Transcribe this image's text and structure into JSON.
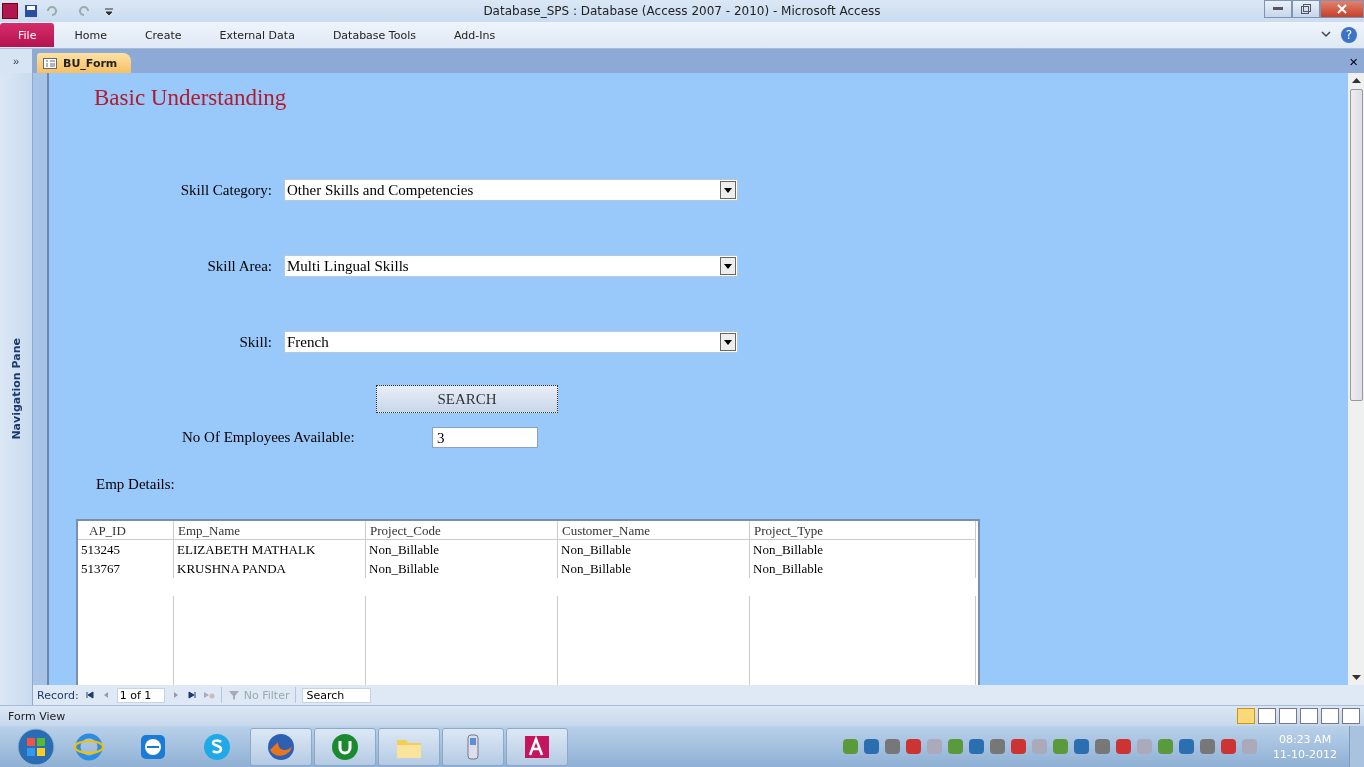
{
  "window": {
    "title": "Database_SPS : Database (Access 2007 - 2010)  -  Microsoft Access"
  },
  "ribbon_tabs": [
    {
      "label": "File",
      "selected": true
    },
    {
      "label": "Home",
      "selected": false
    },
    {
      "label": "Create",
      "selected": false
    },
    {
      "label": "External Data",
      "selected": false
    },
    {
      "label": "Database Tools",
      "selected": false
    },
    {
      "label": "Add-Ins",
      "selected": false
    }
  ],
  "help": "?",
  "navigation_pane": {
    "expand": "»",
    "label": "Navigation Pane"
  },
  "document_tab": {
    "label": "BU_Form",
    "close": "×"
  },
  "form": {
    "title": "Basic Understanding",
    "fields": [
      {
        "label": "Skill Category:",
        "value": "Other Skills and Competencies"
      },
      {
        "label": "Skill Area:",
        "value": "Multi Lingual Skills"
      },
      {
        "label": "Skill:",
        "value": "French"
      }
    ],
    "search_button": "SEARCH",
    "count": {
      "label": "No Of Employees Available:",
      "value": "3"
    },
    "details_label": "Emp Details:",
    "table": {
      "columns": [
        "AP_ID",
        "Emp_Name",
        "Project_Code",
        "Customer_Name",
        "Project_Type"
      ],
      "rows": [
        [
          "513245",
          "ELIZABETH MATHALK",
          "Non_Billable",
          "Non_Billable",
          "Non_Billable"
        ],
        [
          "513767",
          "KRUSHNA PANDA",
          "Non_Billable",
          "Non_Billable",
          "Non_Billable"
        ]
      ]
    }
  },
  "record_bar": {
    "label": "Record:",
    "position": "1 of 1",
    "filter": "No Filter",
    "search": "Search"
  },
  "status_bar": {
    "text": "Form View"
  },
  "clock": {
    "time": "08:23 AM",
    "date": "11-10-2012"
  }
}
